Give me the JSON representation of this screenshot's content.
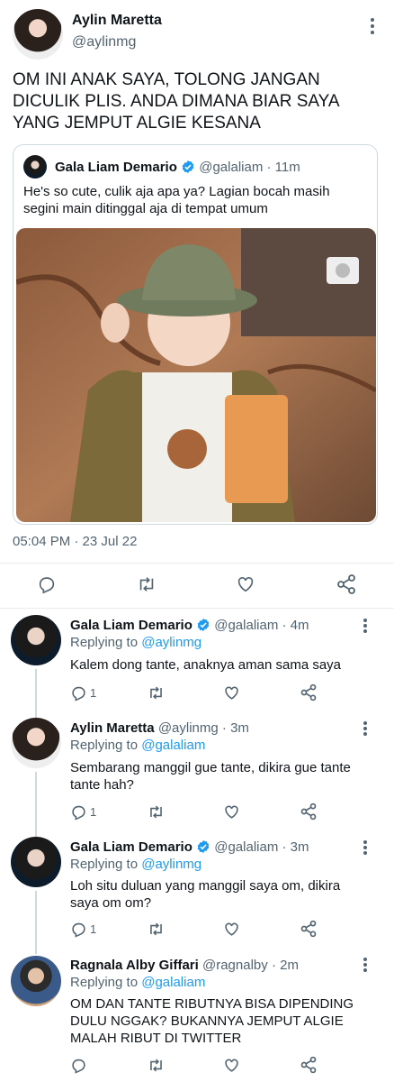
{
  "main_tweet": {
    "name": "Aylin Maretta",
    "handle": "@aylinmg",
    "text_lines": [
      "OM INI ANAK SAYA, TOLONG JANGAN",
      "DICULIK PLIS. ANDA DIMANA BIAR SAYA",
      "YANG JEMPUT ALGIE KESANA"
    ],
    "timestamp": "05:04 PM · 23 Jul 22"
  },
  "quoted": {
    "name": "Gala Liam Demario",
    "handle": "@galaliam",
    "time": "· 11m",
    "text_lines": [
      "He's so cute, culik aja apa ya? Lagian bocah masih",
      "segini main ditinggal aja di tempat umum"
    ]
  },
  "replies": [
    {
      "name": "Gala Liam Demario",
      "handle": "@galaliam",
      "time": "· 4m",
      "replying_prefix": "Replying to",
      "replying_to": "@aylinmg",
      "text_lines": [
        "Kalem dong tante, anaknya aman sama saya"
      ],
      "reply_count": "1"
    },
    {
      "name": "Aylin Maretta",
      "handle": "@aylinmg",
      "time": "· 3m",
      "replying_prefix": "Replying to",
      "replying_to": "@galaliam",
      "text_lines": [
        "Sembarang manggil gue tante, dikira gue tante",
        "tante hah?"
      ],
      "reply_count": "1"
    },
    {
      "name": "Gala Liam Demario",
      "handle": "@galaliam",
      "time": "· 3m",
      "replying_prefix": "Replying to",
      "replying_to": "@aylinmg",
      "text_lines": [
        "Loh situ duluan yang manggil saya om, dikira",
        "saya om om?"
      ],
      "reply_count": "1"
    },
    {
      "name": "Ragnala Alby Giffari",
      "handle": "@ragnalby",
      "time": "· 2m",
      "replying_prefix": "Replying to",
      "replying_to": "@galaliam",
      "text_lines": [
        "OM DAN TANTE RIBUTNYA BISA DIPENDING",
        "DULU NGGAK? BUKANNYA JEMPUT ALGIE",
        "MALAH RIBUT DI TWITTER"
      ],
      "reply_count": ""
    }
  ],
  "colors": {
    "accent": "#1d9bf0",
    "muted": "#536471",
    "text": "#0f1419"
  }
}
